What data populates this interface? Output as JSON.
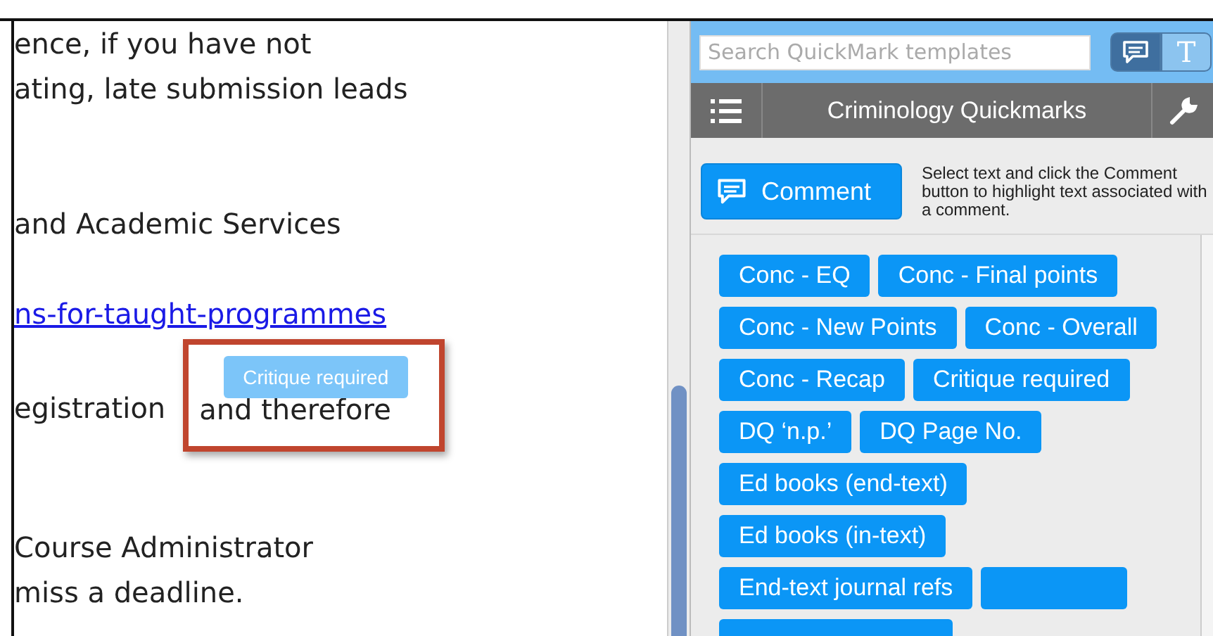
{
  "document": {
    "lines": [
      {
        "kind": "text",
        "text": "ence, if you have not"
      },
      {
        "kind": "text",
        "text": "ating, late submission leads"
      },
      {
        "kind": "text",
        "text": "and Academic Services"
      },
      {
        "kind": "link",
        "text": "ns-for-taught-programmes"
      },
      {
        "kind": "marked",
        "text": "egistration",
        "marked_text": "and therefore",
        "tag": "Critique required"
      },
      {
        "kind": "text",
        "text": "Course Administrator"
      },
      {
        "kind": "text",
        "text": "miss a deadline."
      }
    ]
  },
  "panel": {
    "search": {
      "placeholder": "Search QuickMark templates"
    },
    "modes": [
      {
        "kind": "comment",
        "selected": true
      },
      {
        "kind": "text",
        "label": "T",
        "selected": false
      }
    ],
    "set_title": "Criminology Quickmarks",
    "comment_button": "Comment",
    "help": "Select text and click the Comment button to highlight text associated with a comment.",
    "quickmarks": [
      {
        "kind": "full",
        "label": "Conc - EQ"
      },
      {
        "kind": "full",
        "label": "Conc - Final points"
      },
      {
        "kind": "full",
        "label": "Conc - New Points"
      },
      {
        "kind": "full",
        "label": "Conc - Overall"
      },
      {
        "kind": "full",
        "label": "Conc - Recap"
      },
      {
        "kind": "full",
        "label": "Critique required"
      },
      {
        "kind": "full",
        "label": "DQ ‘n.p.’"
      },
      {
        "kind": "full",
        "label": "DQ Page No."
      },
      {
        "kind": "full",
        "label": "Ed books (end-text)"
      },
      {
        "kind": "full",
        "label": "Ed books (in-text)"
      },
      {
        "kind": "full",
        "label": "End-text journal refs"
      },
      {
        "kind": "clipped"
      },
      {
        "kind": "clipped"
      }
    ]
  }
}
